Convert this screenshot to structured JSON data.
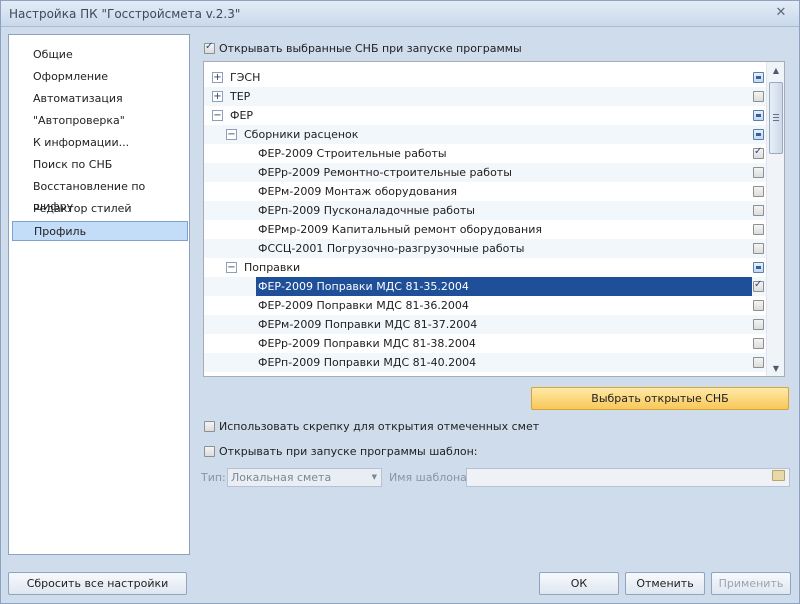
{
  "window": {
    "title": "Настройка ПК \"Госстройсмета v.2.3\"",
    "close_glyph": "✕"
  },
  "nav": {
    "items": [
      {
        "label": "Общие",
        "selected": false
      },
      {
        "label": "Оформление",
        "selected": false
      },
      {
        "label": "Автоматизация",
        "selected": false
      },
      {
        "label": "\"Автопроверка\"",
        "selected": false
      },
      {
        "label": "К информации...",
        "selected": false
      },
      {
        "label": "Поиск по СНБ",
        "selected": false
      },
      {
        "label": "Восстановление по шифру",
        "selected": false
      },
      {
        "label": "Редактор стилей",
        "selected": false
      },
      {
        "label": "Профиль",
        "selected": true
      }
    ]
  },
  "profile": {
    "open_selected_label": "Открывать выбранные СНБ при запуске программы",
    "open_selected_checked": true,
    "tree": [
      {
        "label": "ГЭСН",
        "level": 0,
        "expander": "+",
        "state": "partial"
      },
      {
        "label": "ТЕР",
        "level": 0,
        "expander": "+",
        "state": "unchecked"
      },
      {
        "label": "ФЕР",
        "level": 0,
        "expander": "−",
        "state": "partial"
      },
      {
        "label": "Сборники расценок",
        "level": 1,
        "expander": "−",
        "state": "partial"
      },
      {
        "label": "ФЕР-2009 Строительные работы",
        "level": 2,
        "state": "checked"
      },
      {
        "label": "ФЕРр-2009 Ремонтно-строительные работы",
        "level": 2,
        "state": "unchecked"
      },
      {
        "label": "ФЕРм-2009 Монтаж оборудования",
        "level": 2,
        "state": "unchecked"
      },
      {
        "label": "ФЕРп-2009 Пусконаладочные работы",
        "level": 2,
        "state": "unchecked"
      },
      {
        "label": "ФЕРмр-2009 Капитальный ремонт оборудования",
        "level": 2,
        "state": "unchecked"
      },
      {
        "label": "ФССЦ-2001 Погрузочно-разгрузочные работы",
        "level": 2,
        "state": "unchecked"
      },
      {
        "label": "Поправки",
        "level": 1,
        "expander": "−",
        "state": "partial"
      },
      {
        "label": "ФЕР-2009 Поправки МДС 81-35.2004",
        "level": 2,
        "state": "checked",
        "selected": true
      },
      {
        "label": "ФЕР-2009 Поправки МДС 81-36.2004",
        "level": 2,
        "state": "unchecked"
      },
      {
        "label": "ФЕРм-2009 Поправки МДС 81-37.2004",
        "level": 2,
        "state": "unchecked"
      },
      {
        "label": "ФЕРр-2009 Поправки МДС 81-38.2004",
        "level": 2,
        "state": "unchecked"
      },
      {
        "label": "ФЕРп-2009 Поправки МДС 81-40.2004",
        "level": 2,
        "state": "unchecked"
      }
    ],
    "select_open_button": "Выбрать открытые СНБ",
    "use_clip_label": "Использовать скрепку для открытия отмеченных смет",
    "use_clip_checked": false,
    "open_template_label": "Открывать при запуске программы шаблон:",
    "open_template_checked": false,
    "type_label": "Тип:",
    "type_value": "Локальная смета",
    "template_name_label": "Имя шаблона:",
    "template_name_value": ""
  },
  "footer": {
    "reset_button": "Сбросить все настройки",
    "ok_button": "ОК",
    "cancel_button": "Отменить",
    "apply_button": "Применить"
  },
  "colors": {
    "selection": "#1e4f98",
    "primary_button": "#f8c85a",
    "window_bg": "#cfdcec"
  }
}
